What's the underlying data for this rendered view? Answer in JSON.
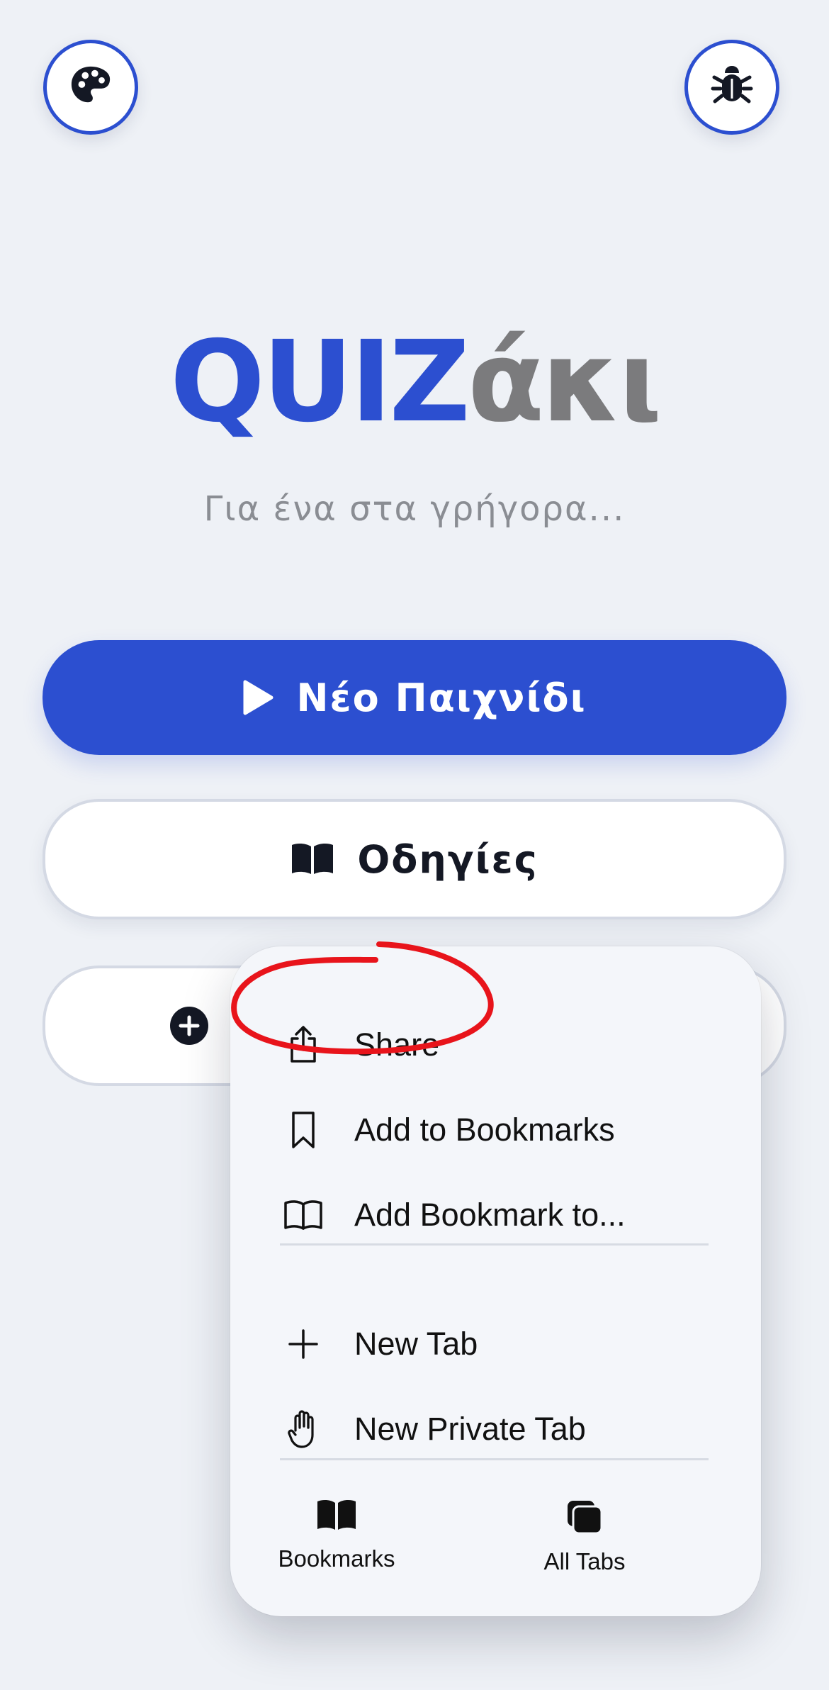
{
  "app": {
    "logo_part1": "QUIZ",
    "logo_part2": "άκι",
    "tagline": "Για ένα στα γρήγορα..."
  },
  "buttons": {
    "new_game": "Νέο Παιχνίδι",
    "instructions": "Οδηγίες"
  },
  "icons": {
    "theme": "palette-icon",
    "debug": "bug-icon",
    "play": "play-icon",
    "book": "book-icon",
    "add": "plus-circle-icon"
  },
  "menu": {
    "items": [
      {
        "label": "Share",
        "icon": "share-icon"
      },
      {
        "label": "Add to Bookmarks",
        "icon": "bookmark-icon"
      },
      {
        "label": "Add Bookmark to...",
        "icon": "open-book-icon"
      },
      {
        "label": "New Tab",
        "icon": "plus-icon"
      },
      {
        "label": "New Private Tab",
        "icon": "hand-icon"
      }
    ],
    "bottom": [
      {
        "label": "Bookmarks",
        "icon": "bookmarks-icon"
      },
      {
        "label": "All Tabs",
        "icon": "tabs-icon"
      }
    ]
  },
  "colors": {
    "brand_blue": "#2c4fd0",
    "logo_gray": "#7b7b7d",
    "background": "#eef1f6",
    "annotation_red": "#e8141b"
  }
}
